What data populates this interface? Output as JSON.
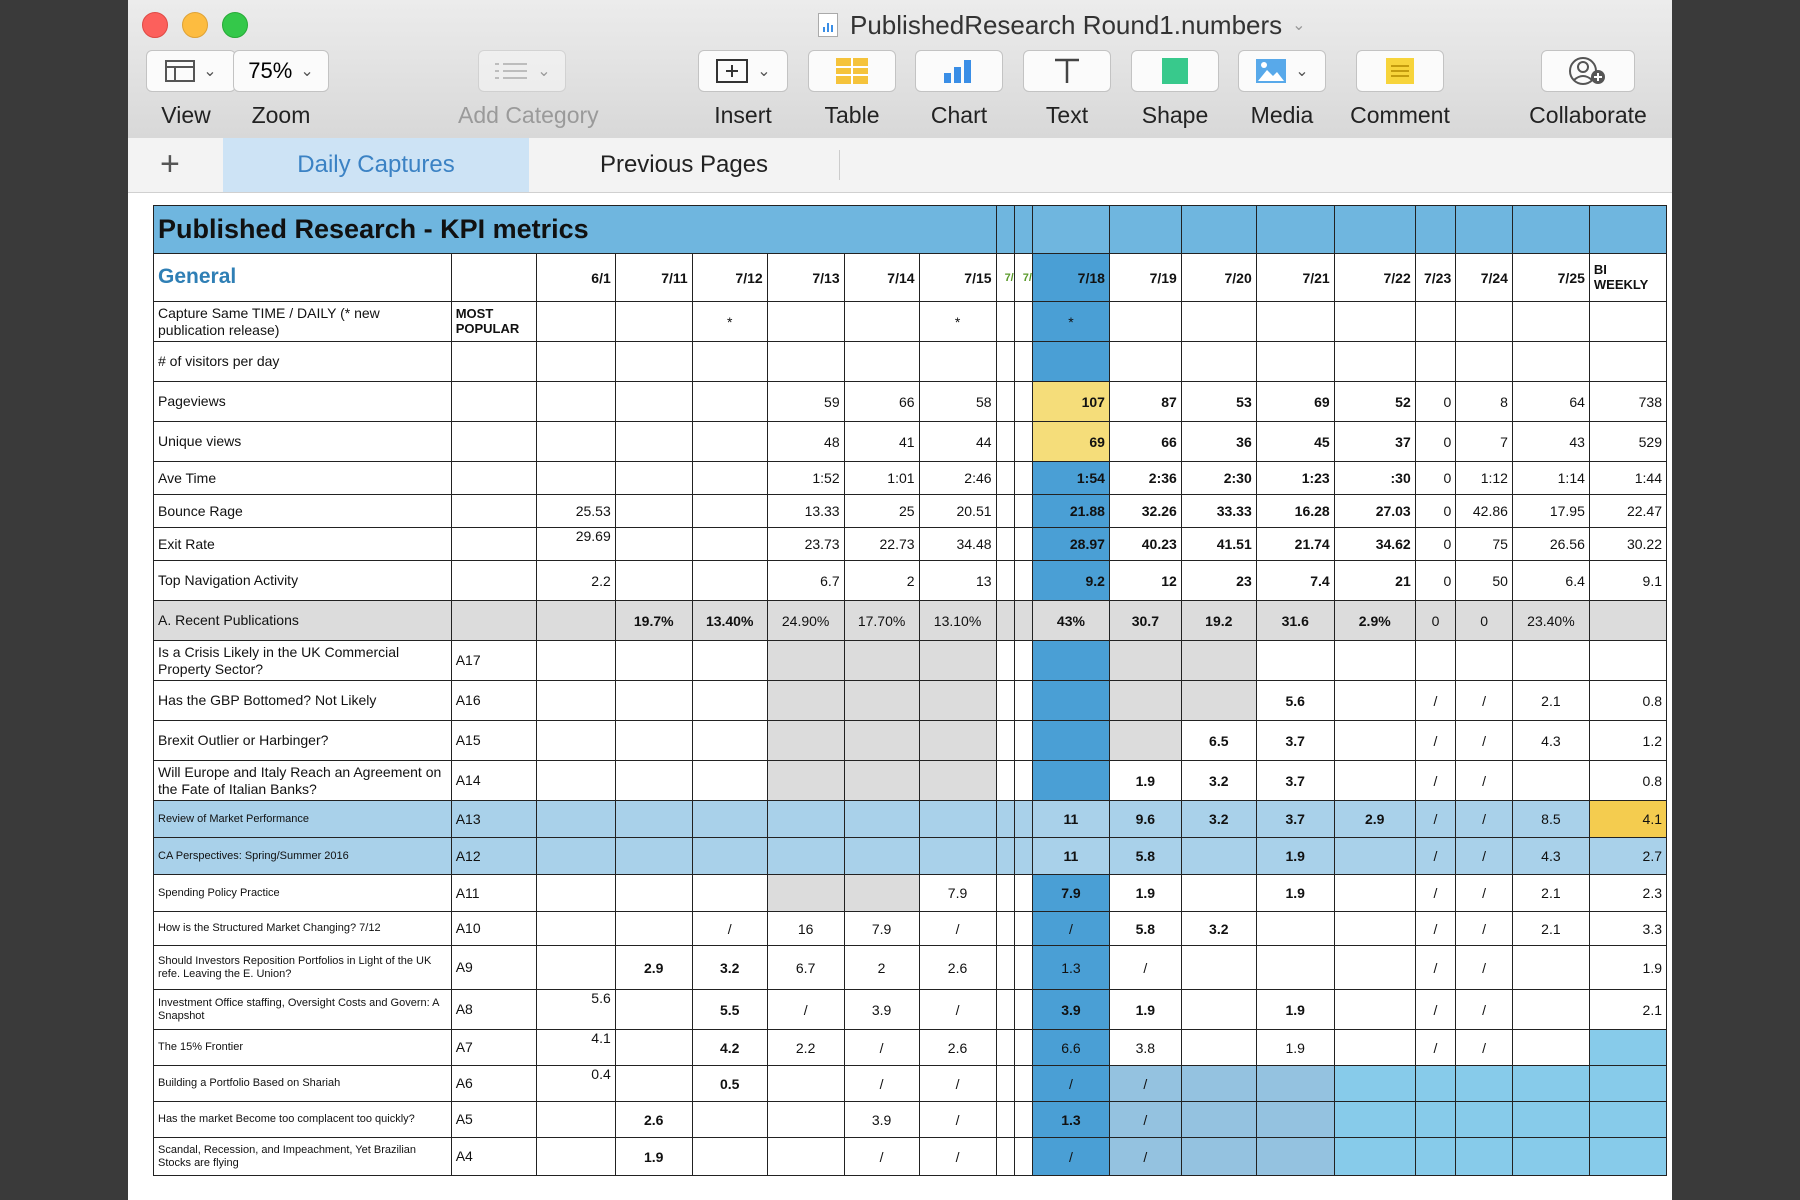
{
  "window": {
    "title": "PublishedResearch Round1.numbers"
  },
  "toolbar": {
    "view": "View",
    "zoom_value": "75%",
    "zoom": "Zoom",
    "add_category": "Add Category",
    "insert": "Insert",
    "table": "Table",
    "chart": "Chart",
    "text": "Text",
    "shape": "Shape",
    "media": "Media",
    "comment": "Comment",
    "collaborate": "Collaborate"
  },
  "tabs": {
    "add": "+",
    "active": "Daily Captures",
    "other": "Previous Pages"
  },
  "sheet": {
    "title": "Published Research - KPI metrics",
    "section": "General",
    "dates": [
      "6/1",
      "7/11",
      "7/12",
      "7/13",
      "7/14",
      "7/15",
      "7/",
      "7/",
      "7/18",
      "7/19",
      "7/20",
      "7/21",
      "7/22",
      "7/23",
      "7/24",
      "7/25"
    ],
    "biweekly": "BI WEEKLY",
    "most_popular": "MOST POPULAR",
    "rows": [
      {
        "label": "Capture Same TIME / DAILY (* new publication release)",
        "code": "",
        "vals": [
          "",
          "",
          "*",
          "",
          "",
          "*",
          "",
          "",
          "*",
          "",
          "",
          "",
          "",
          "",
          "",
          ""
        ],
        "bw": ""
      },
      {
        "label": "# of visitors per day",
        "code": "",
        "vals": [
          "",
          "",
          "",
          "",
          "",
          "",
          "",
          "",
          "",
          "",
          "",
          "",
          "",
          "",
          "",
          ""
        ],
        "bw": ""
      },
      {
        "label": "Pageviews",
        "code": "",
        "vals": [
          "",
          "",
          "",
          "59",
          "66",
          "58",
          "",
          "",
          "107",
          "87",
          "53",
          "69",
          "52",
          "0",
          "8",
          "64"
        ],
        "bw": "738"
      },
      {
        "label": "Unique views",
        "code": "",
        "vals": [
          "",
          "",
          "",
          "48",
          "41",
          "44",
          "",
          "",
          "69",
          "66",
          "36",
          "45",
          "37",
          "0",
          "7",
          "43"
        ],
        "bw": "529"
      },
      {
        "label": "Ave Time",
        "code": "",
        "vals": [
          "",
          "",
          "",
          "1:52",
          "1:01",
          "2:46",
          "",
          "",
          "1:54",
          "2:36",
          "2:30",
          "1:23",
          ":30",
          "0",
          "1:12",
          "1:14"
        ],
        "bw": "1:44"
      },
      {
        "label": "Bounce Rage",
        "code": "",
        "vals": [
          "25.53",
          "",
          "",
          "13.33",
          "25",
          "20.51",
          "",
          "",
          "21.88",
          "32.26",
          "33.33",
          "16.28",
          "27.03",
          "0",
          "42.86",
          "17.95"
        ],
        "bw": "22.47"
      },
      {
        "label": "Exit Rate",
        "code": "",
        "vals": [
          "29.69",
          "",
          "",
          "23.73",
          "22.73",
          "34.48",
          "",
          "",
          "28.97",
          "40.23",
          "41.51",
          "21.74",
          "34.62",
          "0",
          "75",
          "26.56"
        ],
        "bw": "30.22"
      },
      {
        "label": "Top Navigation Activity",
        "code": "",
        "vals": [
          "2.2",
          "",
          "",
          "6.7",
          "2",
          "13",
          "",
          "",
          "9.2",
          "12",
          "23",
          "7.4",
          "21",
          "0",
          "50",
          "6.4"
        ],
        "bw": "9.1"
      },
      {
        "label": "A. Recent Publications",
        "code": "",
        "vals": [
          "",
          "19.7%",
          "13.40%",
          "24.90%",
          "17.70%",
          "13.10%",
          "",
          "",
          "43%",
          "30.7",
          "19.2",
          "31.6",
          "2.9%",
          "0",
          "0",
          "23.40%"
        ],
        "bw": ""
      },
      {
        "label": "Is a Crisis Likely in the UK Commercial Property Sector?",
        "code": "A17",
        "vals": [
          "",
          "",
          "",
          "",
          "",
          "",
          "",
          "",
          "",
          "",
          "",
          "",
          "",
          "",
          "",
          ""
        ],
        "bw": ""
      },
      {
        "label": "Has the GBP Bottomed? Not Likely",
        "code": "A16",
        "vals": [
          "",
          "",
          "",
          "",
          "",
          "",
          "",
          "",
          "",
          "",
          "",
          "5.6",
          "",
          "/",
          "/",
          "2.1"
        ],
        "bw": "0.8"
      },
      {
        "label": "Brexit Outlier or Harbinger?",
        "code": "A15",
        "vals": [
          "",
          "",
          "",
          "",
          "",
          "",
          "",
          "",
          "",
          "",
          "6.5",
          "3.7",
          "",
          "/",
          "/",
          "4.3"
        ],
        "bw": "1.2"
      },
      {
        "label": "Will Europe and Italy Reach an Agreement on the Fate of Italian Banks?",
        "code": "A14",
        "vals": [
          "",
          "",
          "",
          "",
          "",
          "",
          "",
          "",
          "",
          "1.9",
          "3.2",
          "3.7",
          "",
          "/",
          "/",
          ""
        ],
        "bw": "0.8"
      },
      {
        "label": "Review of Market Performance",
        "code": "A13",
        "vals": [
          "",
          "",
          "",
          "",
          "",
          "",
          "",
          "",
          "11",
          "9.6",
          "3.2",
          "3.7",
          "2.9",
          "/",
          "/",
          "8.5"
        ],
        "bw": "4.1"
      },
      {
        "label": "CA Perspectives: Spring/Summer 2016",
        "code": "A12",
        "vals": [
          "",
          "",
          "",
          "",
          "",
          "",
          "",
          "",
          "11",
          "5.8",
          "",
          "1.9",
          "",
          "/",
          "/",
          "4.3"
        ],
        "bw": "2.7"
      },
      {
        "label": "Spending Policy Practice",
        "code": "A11",
        "vals": [
          "",
          "",
          "",
          "",
          "",
          "7.9",
          "",
          "",
          "7.9",
          "1.9",
          "",
          "1.9",
          "",
          "/",
          "/",
          "2.1"
        ],
        "bw": "2.3"
      },
      {
        "label": "How is the Structured Market Changing? 7/12",
        "code": "A10",
        "vals": [
          "",
          "",
          "/",
          "16",
          "7.9",
          "/",
          "",
          "",
          "/",
          "5.8",
          "3.2",
          "",
          "",
          "/",
          "/",
          "2.1"
        ],
        "bw": "3.3"
      },
      {
        "label": "Should Investors Reposition Portfolios in Light of the UK refe. Leaving the E. Union?",
        "code": "A9",
        "vals": [
          "",
          "2.9",
          "3.2",
          "6.7",
          "2",
          "2.6",
          "",
          "",
          "1.3",
          "/",
          "",
          "",
          "",
          "/",
          "/",
          ""
        ],
        "bw": "1.9"
      },
      {
        "label": "Investment Office staffing, Oversight Costs and Govern: A Snapshot",
        "code": "A8",
        "vals": [
          "5.6",
          "",
          "5.5",
          "/",
          "3.9",
          "/",
          "",
          "",
          "3.9",
          "1.9",
          "",
          "1.9",
          "",
          "/",
          "/",
          ""
        ],
        "bw": "2.1"
      },
      {
        "label": "The 15% Frontier",
        "code": "A7",
        "vals": [
          "4.1",
          "",
          "4.2",
          "2.2",
          "/",
          "2.6",
          "",
          "",
          "6.6",
          "3.8",
          "",
          "1.9",
          "",
          "/",
          "/",
          ""
        ],
        "bw": ""
      },
      {
        "label": "Building a Portfolio Based on Shariah",
        "code": "A6",
        "vals": [
          "0.4",
          "",
          "0.5",
          "",
          "/",
          "/",
          "",
          "",
          "/",
          "/",
          "",
          "",
          "",
          "",
          "",
          ""
        ],
        "bw": ""
      },
      {
        "label": "Has the market Become too complacent too quickly?",
        "code": "A5",
        "vals": [
          "",
          "2.6",
          "",
          "",
          "3.9",
          "/",
          "",
          "",
          "1.3",
          "/",
          "",
          "",
          "",
          "",
          "",
          ""
        ],
        "bw": ""
      },
      {
        "label": "Scandal, Recession, and Impeachment, Yet Brazilian Stocks are flying",
        "code": "A4",
        "vals": [
          "",
          "1.9",
          "",
          "",
          "/",
          "/",
          "",
          "",
          "/",
          "/",
          "",
          "",
          "",
          "",
          "",
          ""
        ],
        "bw": ""
      }
    ]
  }
}
